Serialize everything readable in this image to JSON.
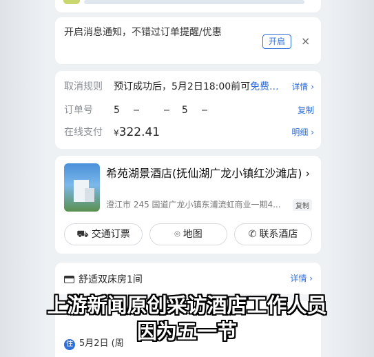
{
  "notification": {
    "text": "开启消息通知，不错过订单提醒/优惠",
    "open_label": "开启",
    "close_glyph": "×"
  },
  "order": {
    "cancel_label": "取消规则",
    "cancel_value": "预订成功后，5月2日18:00前可",
    "cancel_free": "免费...",
    "cancel_link": "详情 ›",
    "number_label": "订单号",
    "number_value": "5",
    "number_tail": "5",
    "number_copy": "复制",
    "pay_label": "在线支付",
    "pay_currency": "¥",
    "pay_amount": "322.41",
    "pay_link": "明细 ›"
  },
  "hotel": {
    "name": "希苑湖景酒店(抚仙湖广龙小镇红沙滩店) ›",
    "address": "澄江市 245 国道广龙小镇东浦流虹商业一期4...",
    "copy_label": "复制",
    "transport_label": "交通订票",
    "map_label": "地图",
    "contact_label": "联系酒店"
  },
  "room": {
    "title": "舒适双床房1间",
    "detail_link": "详情 ›",
    "checkin_badge": "住",
    "checkin_text": "5月2日 (周"
  },
  "subtitles": {
    "line1": "上游新闻原创采访酒店工作人员",
    "line2": "因为五一节"
  },
  "colors": {
    "accent": "#2f6fd8",
    "price": "#e0302c"
  }
}
